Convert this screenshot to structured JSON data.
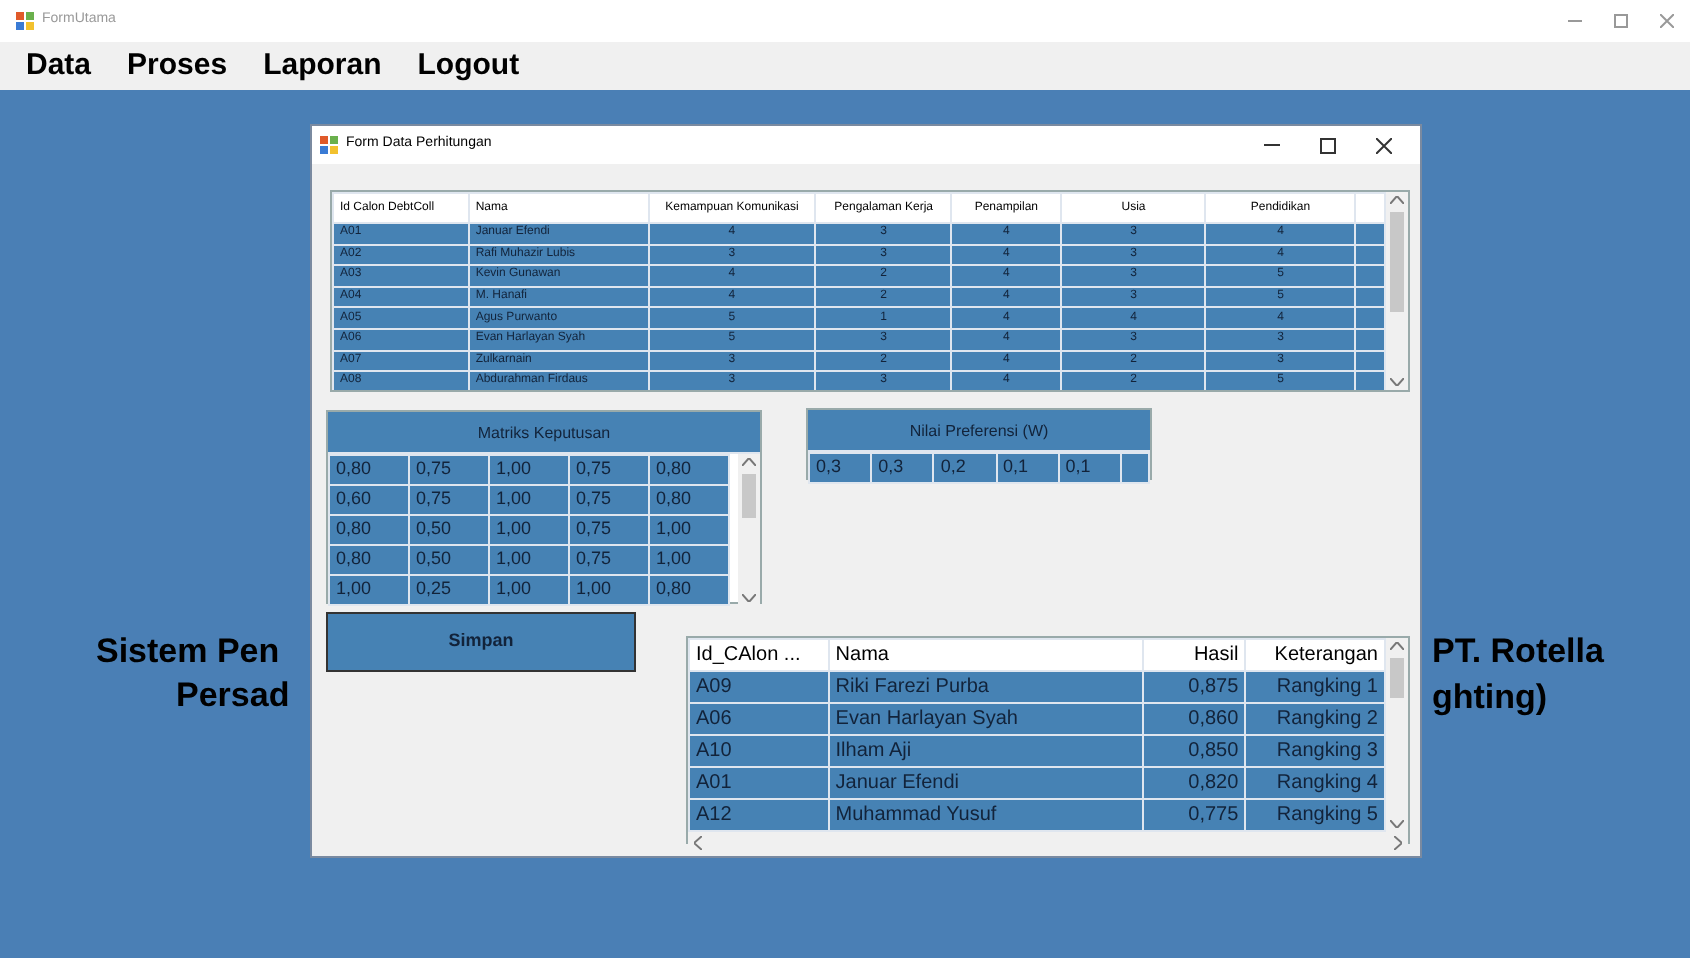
{
  "app_window": {
    "title": "FormUtama"
  },
  "menu": [
    "Data",
    "Proses",
    "Laporan",
    "Logout"
  ],
  "background_heading": {
    "left_fragments": [
      "Sistem Pen",
      "Persad"
    ],
    "right_fragments": [
      "PT. Rotella",
      "ghting)"
    ]
  },
  "dialog": {
    "title": "Form Data Perhitungan",
    "candidates_table": {
      "columns": [
        "Id Calon DebtColl",
        "Nama",
        "Kemampuan Komunikasi",
        "Pengalaman Kerja",
        "Penampilan",
        "Usia",
        "Pendidikan"
      ],
      "rows": [
        [
          "A01",
          "Januar Efendi",
          "4",
          "3",
          "4",
          "3",
          "4"
        ],
        [
          "A02",
          "Rafi Muhazir Lubis",
          "3",
          "3",
          "4",
          "3",
          "4"
        ],
        [
          "A03",
          "Kevin Gunawan",
          "4",
          "2",
          "4",
          "3",
          "5"
        ],
        [
          "A04",
          "M. Hanafi",
          "4",
          "2",
          "4",
          "3",
          "5"
        ],
        [
          "A05",
          "Agus Purwanto",
          "5",
          "1",
          "4",
          "4",
          "4"
        ],
        [
          "A06",
          "Evan Harlayan Syah",
          "5",
          "3",
          "4",
          "3",
          "3"
        ],
        [
          "A07",
          "Zulkarnain",
          "3",
          "2",
          "4",
          "2",
          "3"
        ],
        [
          "A08",
          "Abdurahman Firdaus",
          "3",
          "3",
          "4",
          "2",
          "5"
        ]
      ]
    },
    "decision_matrix": {
      "title": "Matriks Keputusan",
      "rows": [
        [
          "0,80",
          "0,75",
          "1,00",
          "0,75",
          "0,80"
        ],
        [
          "0,60",
          "0,75",
          "1,00",
          "0,75",
          "0,80"
        ],
        [
          "0,80",
          "0,50",
          "1,00",
          "0,75",
          "1,00"
        ],
        [
          "0,80",
          "0,50",
          "1,00",
          "0,75",
          "1,00"
        ],
        [
          "1,00",
          "0,25",
          "1,00",
          "1,00",
          "0,80"
        ]
      ]
    },
    "preference_weights": {
      "title": "Nilai Preferensi (W)",
      "values": [
        "0,3",
        "0,3",
        "0,2",
        "0,1",
        "0,1"
      ]
    },
    "save_button": "Simpan",
    "ranking_table": {
      "columns": [
        "Id_CAlon ...",
        "Nama",
        "Hasil",
        "Keterangan"
      ],
      "rows": [
        [
          "A09",
          "Riki Farezi Purba",
          "0,875",
          "Rangking 1"
        ],
        [
          "A06",
          "Evan Harlayan Syah",
          "0,860",
          "Rangking 2"
        ],
        [
          "A10",
          "Ilham Aji",
          "0,850",
          "Rangking 3"
        ],
        [
          "A01",
          "Januar Efendi",
          "0,820",
          "Rangking 4"
        ],
        [
          "A12",
          "Muhammad Yusuf",
          "0,775",
          "Rangking 5"
        ]
      ]
    }
  }
}
